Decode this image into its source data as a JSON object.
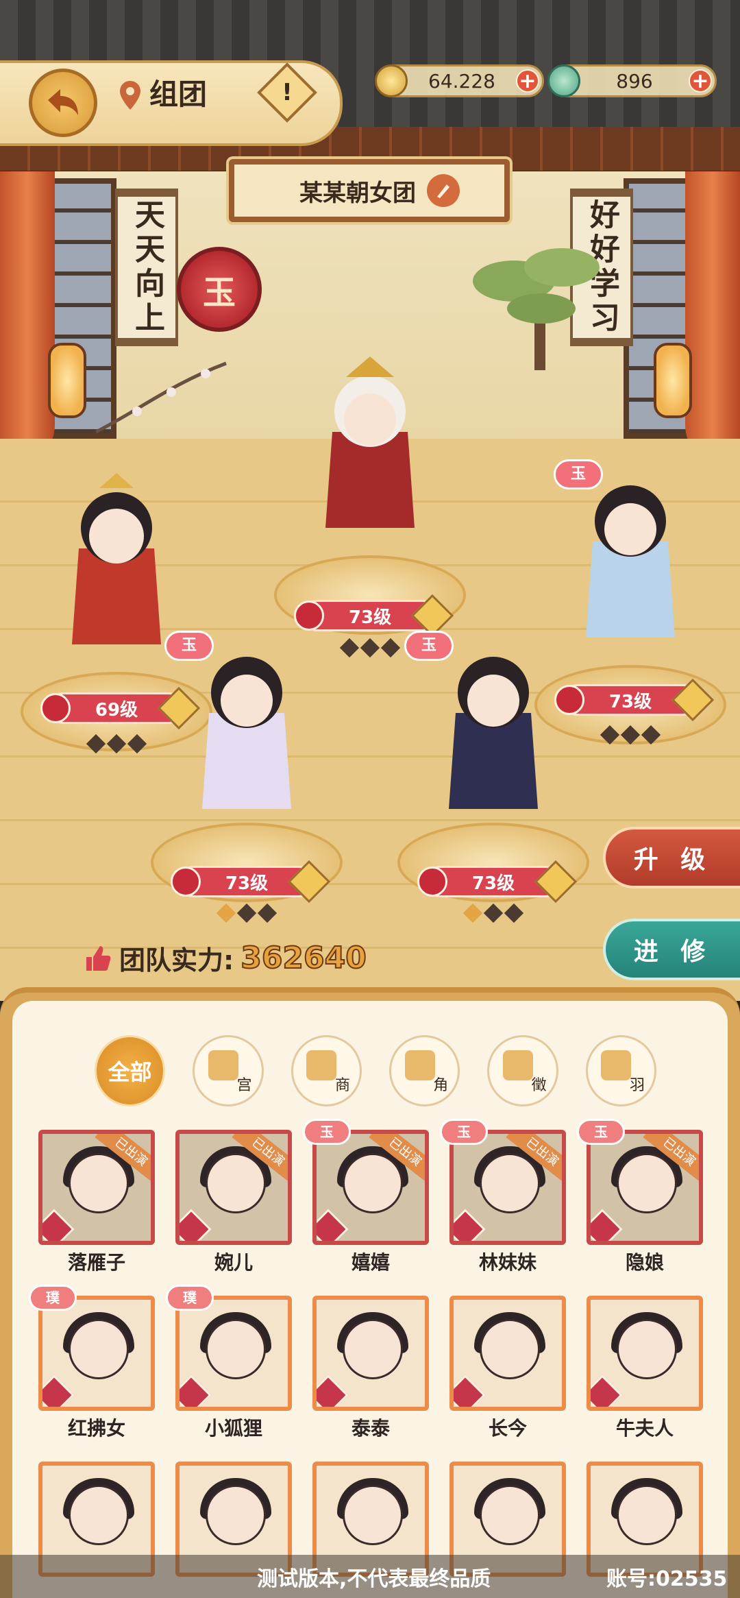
{
  "header": {
    "title": "组团",
    "info_glyph": "!",
    "coins": "64.228",
    "jade": "896",
    "plus_glyph": "+"
  },
  "team": {
    "name": "某某朝女团",
    "rank_glyph": "玉"
  },
  "banners": {
    "left": "天天向上",
    "right": "好好学习"
  },
  "stage": [
    {
      "level": "69级",
      "stars_gold": 0
    },
    {
      "level": "73级",
      "stars_gold": 0
    },
    {
      "level": "73级",
      "stars_gold": 0
    },
    {
      "level": "73级",
      "stars_gold": 1
    },
    {
      "level": "73级",
      "stars_gold": 1
    }
  ],
  "stage_tags": {
    "jade": "玉"
  },
  "side_buttons": {
    "upgrade": "升 级",
    "train": "进 修"
  },
  "power": {
    "label": "团队实力:",
    "value": "362640"
  },
  "filters": [
    {
      "label": "全部",
      "icon": "all"
    },
    {
      "label": "宫",
      "icon": "drum-icon"
    },
    {
      "label": "商",
      "icon": "bell-icon"
    },
    {
      "label": "角",
      "icon": "flute-icon"
    },
    {
      "label": "徵",
      "icon": "pipa-icon"
    },
    {
      "label": "羽",
      "icon": "zither-icon"
    }
  ],
  "cards": [
    {
      "name": "落雁子",
      "badge": "已出演",
      "tag": ""
    },
    {
      "name": "婉儿",
      "badge": "已出演",
      "tag": ""
    },
    {
      "name": "嬉嬉",
      "badge": "已出演",
      "tag": "玉"
    },
    {
      "name": "林妹妹",
      "badge": "已出演",
      "tag": "玉"
    },
    {
      "name": "隐娘",
      "badge": "已出演",
      "tag": "玉"
    },
    {
      "name": "红拂女",
      "badge": "",
      "tag": "璞"
    },
    {
      "name": "小狐狸",
      "badge": "",
      "tag": "璞"
    },
    {
      "name": "泰泰",
      "badge": "",
      "tag": ""
    },
    {
      "name": "长今",
      "badge": "",
      "tag": ""
    },
    {
      "name": "牛夫人",
      "badge": "",
      "tag": ""
    }
  ],
  "watermark": {
    "text": "测试版本,不代表最终品质",
    "account": "账号:02535"
  },
  "colors": {
    "accent": "#d9434f",
    "gold": "#e8a23d",
    "teal": "#25837a"
  }
}
